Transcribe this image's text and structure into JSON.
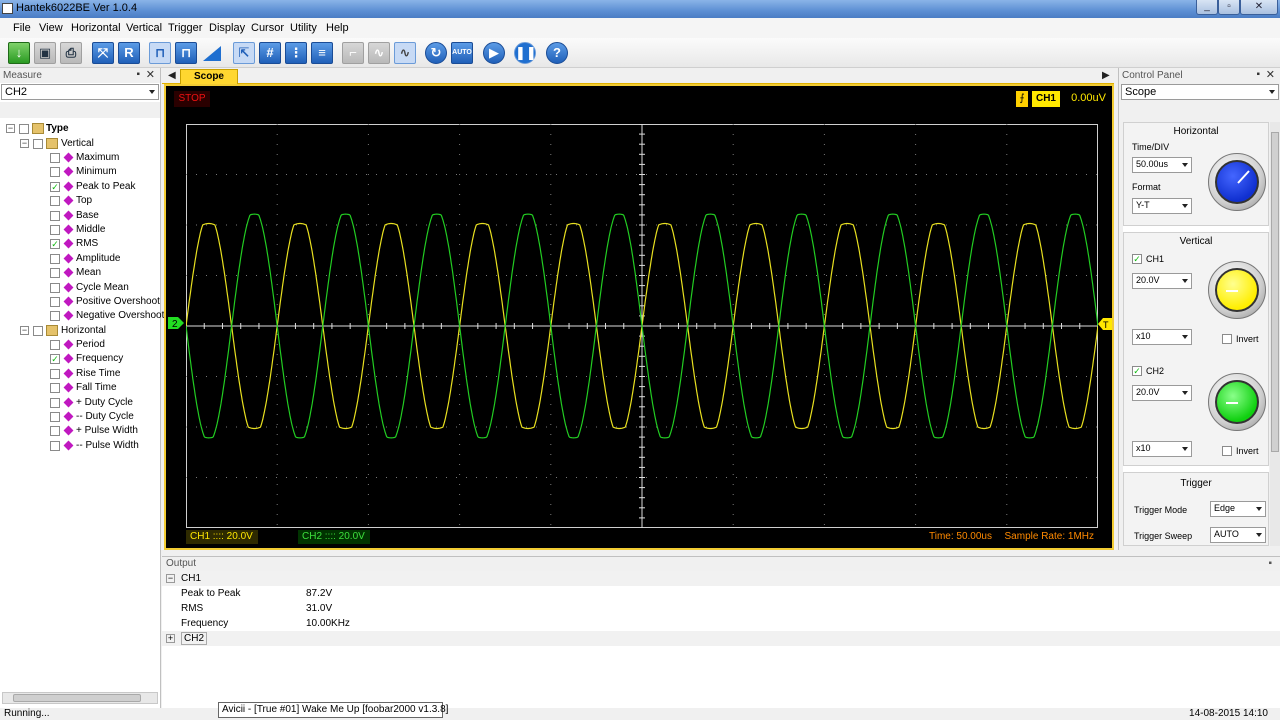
{
  "window": {
    "title": "Hantek6022BE Ver 1.0.4"
  },
  "menu": [
    "File",
    "View",
    "Horizontal",
    "Vertical",
    "Trigger",
    "Display",
    "Cursor",
    "Utility",
    "Help"
  ],
  "toolbar": {
    "icons": [
      "open-icon",
      "save-icon",
      "print-icon",
      "auto-set-icon",
      "reset-icon",
      "pulse-icon",
      "multi-pulse-icon",
      "ramp-icon",
      "cursor-select-icon",
      "grid-icon",
      "split-grid-icon",
      "lines-icon",
      "step-icon",
      "sine-icon",
      "sine-selected-icon",
      "refresh-icon",
      "auto-icon",
      "play-icon",
      "pause-icon",
      "help-icon"
    ],
    "auto_label": "AUTO"
  },
  "measure": {
    "title": "Measure",
    "channel": "CH2",
    "tree": {
      "root": "Type",
      "vertical_label": "Vertical",
      "vertical": [
        {
          "label": "Maximum",
          "checked": false
        },
        {
          "label": "Minimum",
          "checked": false
        },
        {
          "label": "Peak to Peak",
          "checked": true
        },
        {
          "label": "Top",
          "checked": false
        },
        {
          "label": "Base",
          "checked": false
        },
        {
          "label": "Middle",
          "checked": false
        },
        {
          "label": "RMS",
          "checked": true
        },
        {
          "label": "Amplitude",
          "checked": false
        },
        {
          "label": "Mean",
          "checked": false
        },
        {
          "label": "Cycle Mean",
          "checked": false
        },
        {
          "label": "Positive Overshoot",
          "checked": false
        },
        {
          "label": "Negative Overshoot",
          "checked": false
        }
      ],
      "horizontal_label": "Horizontal",
      "horizontal": [
        {
          "label": "Period",
          "checked": false
        },
        {
          "label": "Frequency",
          "checked": true
        },
        {
          "label": "Rise Time",
          "checked": false
        },
        {
          "label": "Fall Time",
          "checked": false
        },
        {
          "label": "+ Duty Cycle",
          "checked": false
        },
        {
          "label": "-- Duty Cycle",
          "checked": false
        },
        {
          "label": "+ Pulse Width",
          "checked": false
        },
        {
          "label": "-- Pulse Width",
          "checked": false
        }
      ]
    }
  },
  "scope": {
    "tab": "Scope",
    "state": "STOP",
    "trigger_source": "CH1",
    "trigger_level": "0.00uV",
    "ch1_label": "CH1 ::::  20.0V",
    "ch2_label": "CH2 ::::  20.0V",
    "time": "Time: 50.00us",
    "sample_rate": "Sample Rate: 1MHz",
    "ch2_marker": "2",
    "trigger_marker": "T"
  },
  "control_panel": {
    "title": "Control Panel",
    "mode": "Scope",
    "horizontal": {
      "title": "Horizontal",
      "time_div_label": "Time/DIV",
      "time_div": "50.00us",
      "format_label": "Format",
      "format": "Y-T"
    },
    "vertical": {
      "title": "Vertical",
      "ch1": {
        "label": "CH1",
        "checked": true,
        "volts": "20.0V",
        "probe": "x10",
        "invert_label": "Invert",
        "color": "#ffe800"
      },
      "ch2": {
        "label": "CH2",
        "checked": true,
        "volts": "20.0V",
        "probe": "x10",
        "invert_label": "Invert",
        "color": "#22dd22"
      }
    },
    "trigger": {
      "title": "Trigger",
      "mode_label": "Trigger Mode",
      "mode": "Edge",
      "sweep_label": "Trigger Sweep",
      "sweep": "AUTO"
    },
    "horizontal_knob_color": "#1030d0"
  },
  "output": {
    "title": "Output",
    "groups": [
      {
        "name": "CH1",
        "rows": [
          {
            "name": "Peak to Peak",
            "value": "87.2V"
          },
          {
            "name": "RMS",
            "value": "31.0V"
          },
          {
            "name": "Frequency",
            "value": "10.00KHz"
          }
        ]
      },
      {
        "name": "CH2",
        "rows": []
      }
    ]
  },
  "statusbar": {
    "left": "Running...",
    "tooltip": "Avicii - [True #01] Wake Me Up  [foobar2000 v1.3.8]",
    "clock": "14-08-2015  14:10"
  },
  "chart_data": {
    "type": "line",
    "divisions": {
      "x": 10,
      "y": 8
    },
    "xlim": [
      0,
      10
    ],
    "ylim": [
      -4,
      4
    ],
    "series": [
      {
        "name": "CH1",
        "color": "#e8e020",
        "cycles": 10,
        "amplitude_div": 2.2,
        "phase": 0,
        "clip_div": 2.0
      },
      {
        "name": "CH2",
        "color": "#22cc22",
        "cycles": 10,
        "amplitude_div": 2.3,
        "phase": 3.14159,
        "clip_div": 2.2
      }
    ]
  }
}
